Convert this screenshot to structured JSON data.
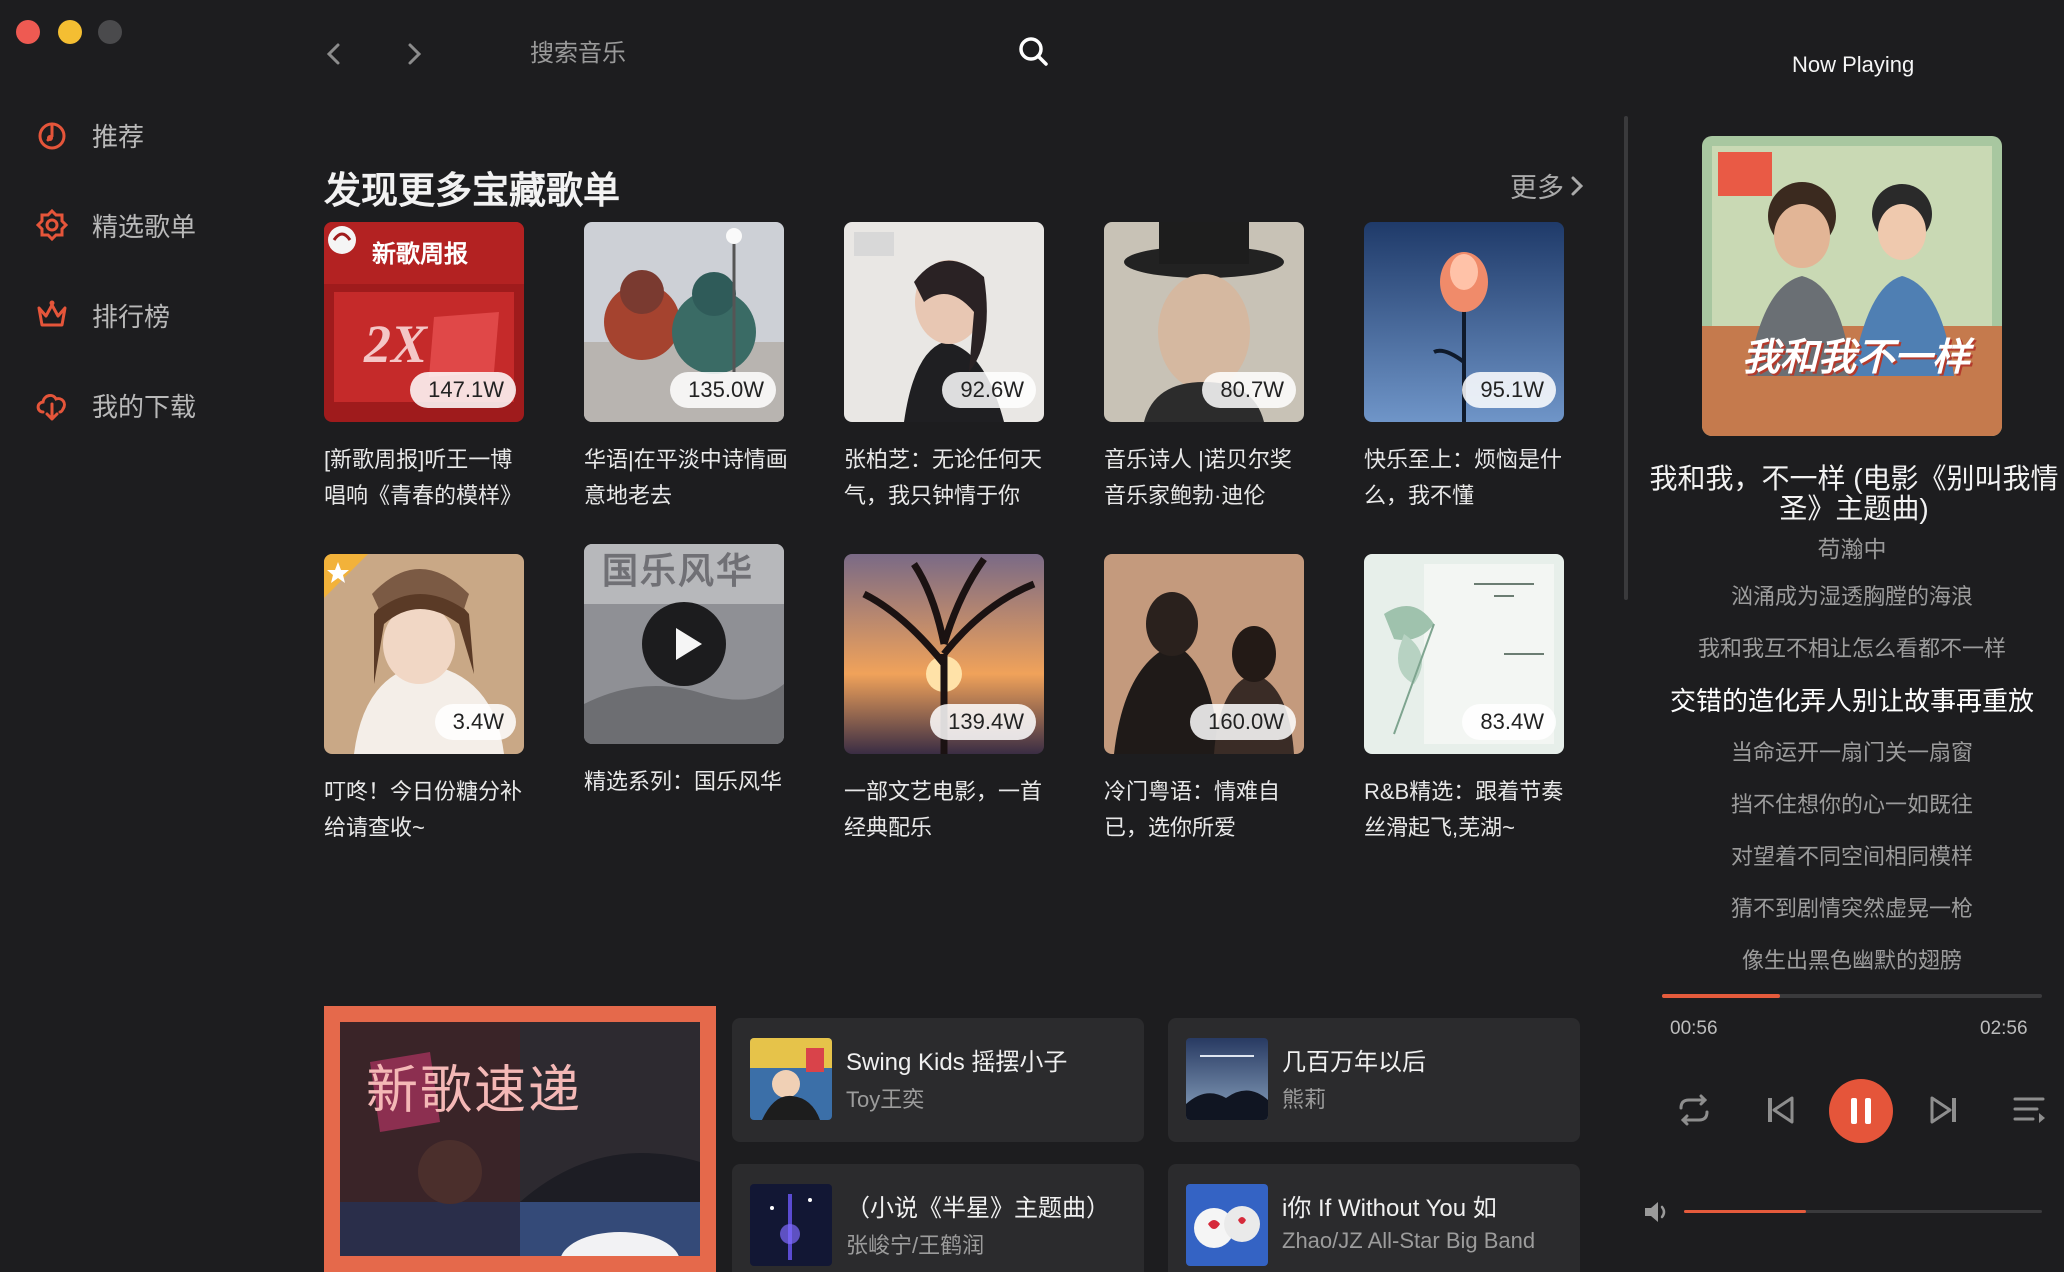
{
  "search": {
    "placeholder": "搜索音乐"
  },
  "sidebar": {
    "items": [
      {
        "label": "推荐",
        "icon": "recommend-icon"
      },
      {
        "label": "精选歌单",
        "icon": "playlist-icon"
      },
      {
        "label": "排行榜",
        "icon": "chart-crown-icon"
      },
      {
        "label": "我的下载",
        "icon": "cloud-download-icon"
      }
    ]
  },
  "main": {
    "section_title": "发现更多宝藏歌单",
    "more_label": "更多",
    "playlists": [
      {
        "title": "[新歌周报]听王一博唱响《青春的模样》",
        "count": "147.1W",
        "badge": "新歌周报"
      },
      {
        "title": "华语|在平淡中诗情画意地老去",
        "count": "135.0W"
      },
      {
        "title": "张柏芝：无论任何天气，我只钟情于你",
        "count": "92.6W"
      },
      {
        "title": "音乐诗人 |诺贝尔奖音乐家鲍勃·迪伦",
        "count": "80.7W"
      },
      {
        "title": "快乐至上：烦恼是什么，我不懂",
        "count": "95.1W"
      },
      {
        "title": "叮咚！今日份糖分补给请查收~",
        "count": "3.4W"
      },
      {
        "title": "精选系列：国乐风华",
        "count": "",
        "cover_text": "国乐风华"
      },
      {
        "title": "一部文艺电影，一首经典配乐",
        "count": "139.4W"
      },
      {
        "title": "冷门粤语：情难自已，选你所爱",
        "count": "160.0W"
      },
      {
        "title": "R&B精选：跟着节奏丝滑起飞,芜湖~",
        "count": "83.4W"
      }
    ],
    "new_songs": {
      "title": "新歌速递",
      "songs": [
        {
          "name": "Swing Kids 摇摆小子",
          "artist": "Toy王奕"
        },
        {
          "name": "几百万年以后",
          "artist": "熊莉"
        },
        {
          "name": "（小说《半星》主题曲）",
          "artist": "张峻宁/王鹤润"
        },
        {
          "name": "i你 If Without You      如",
          "artist": "Zhao/JZ All-Star Big Band"
        }
      ]
    }
  },
  "now_playing": {
    "header": "Now Playing",
    "song": "我和我，不一样 (电影《别叫我情圣》主题曲)",
    "artist": "苟瀚中",
    "cover_text": "我和我不一样",
    "lyrics": [
      "汹涌成为湿透胸膛的海浪",
      "我和我互不相让怎么看都不一样",
      "交错的造化弄人别让故事再重放",
      "当命运开一扇门关一扇窗",
      "挡不住想你的心一如既往",
      "对望着不同空间相同模样",
      "猜不到剧情突然虚晃一枪",
      "像生出黑色幽默的翅膀"
    ],
    "active_lyric": 2,
    "current_time": "00:56",
    "duration": "02:56",
    "progress": 0.31,
    "volume": 0.34
  },
  "colors": {
    "accent": "#e5553a",
    "background": "#1d1d1f",
    "card": "#2b2b2d"
  }
}
